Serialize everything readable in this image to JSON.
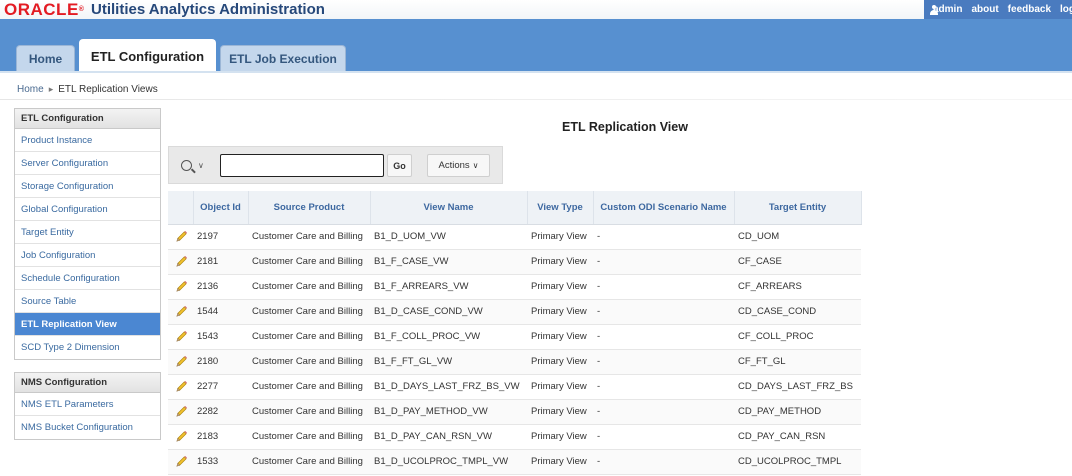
{
  "header": {
    "logo_text": "ORACLE",
    "app_title": "Utilities Analytics Administration",
    "user": "admin",
    "links": [
      "about",
      "feedback",
      "logout"
    ]
  },
  "tabs": [
    {
      "label": "Home"
    },
    {
      "label": "ETL Configuration"
    },
    {
      "label": "ETL Job Execution"
    }
  ],
  "breadcrumb": {
    "home": "Home",
    "current": "ETL Replication Views"
  },
  "sidebar": {
    "etl_title": "ETL Configuration",
    "etl_items": [
      "Product Instance",
      "Server Configuration",
      "Storage Configuration",
      "Global Configuration",
      "Target Entity",
      "Job Configuration",
      "Schedule Configuration",
      "Source Table",
      "ETL Replication View",
      "SCD Type 2 Dimension"
    ],
    "nms_title": "NMS Configuration",
    "nms_items": [
      "NMS ETL Parameters",
      "NMS Bucket Configuration"
    ]
  },
  "main": {
    "title": "ETL Replication View",
    "search_value": "",
    "go_label": "Go",
    "actions_label": "Actions"
  },
  "table": {
    "columns": [
      "",
      "Object Id",
      "Source Product",
      "View Name",
      "View Type",
      "Custom ODI Scenario Name",
      "Target Entity"
    ],
    "rows": [
      [
        "2197",
        "Customer Care and Billing",
        "B1_D_UOM_VW",
        "Primary View",
        "-",
        "CD_UOM"
      ],
      [
        "2181",
        "Customer Care and Billing",
        "B1_F_CASE_VW",
        "Primary View",
        "-",
        "CF_CASE"
      ],
      [
        "2136",
        "Customer Care and Billing",
        "B1_F_ARREARS_VW",
        "Primary View",
        "-",
        "CF_ARREARS"
      ],
      [
        "1544",
        "Customer Care and Billing",
        "B1_D_CASE_COND_VW",
        "Primary View",
        "-",
        "CD_CASE_COND"
      ],
      [
        "1543",
        "Customer Care and Billing",
        "B1_F_COLL_PROC_VW",
        "Primary View",
        "-",
        "CF_COLL_PROC"
      ],
      [
        "2180",
        "Customer Care and Billing",
        "B1_F_FT_GL_VW",
        "Primary View",
        "-",
        "CF_FT_GL"
      ],
      [
        "2277",
        "Customer Care and Billing",
        "B1_D_DAYS_LAST_FRZ_BS_VW",
        "Primary View",
        "-",
        "CD_DAYS_LAST_FRZ_BS"
      ],
      [
        "2282",
        "Customer Care and Billing",
        "B1_D_PAY_METHOD_VW",
        "Primary View",
        "-",
        "CD_PAY_METHOD"
      ],
      [
        "2183",
        "Customer Care and Billing",
        "B1_D_PAY_CAN_RSN_VW",
        "Primary View",
        "-",
        "CD_PAY_CAN_RSN"
      ],
      [
        "1533",
        "Customer Care and Billing",
        "B1_D_UCOLPROC_TMPL_VW",
        "Primary View",
        "-",
        "CD_UCOLPROC_TMPL"
      ]
    ]
  },
  "colors": {
    "accent": "#5790d0",
    "active_item": "#4b87d2",
    "logo_red": "#e31b23"
  }
}
